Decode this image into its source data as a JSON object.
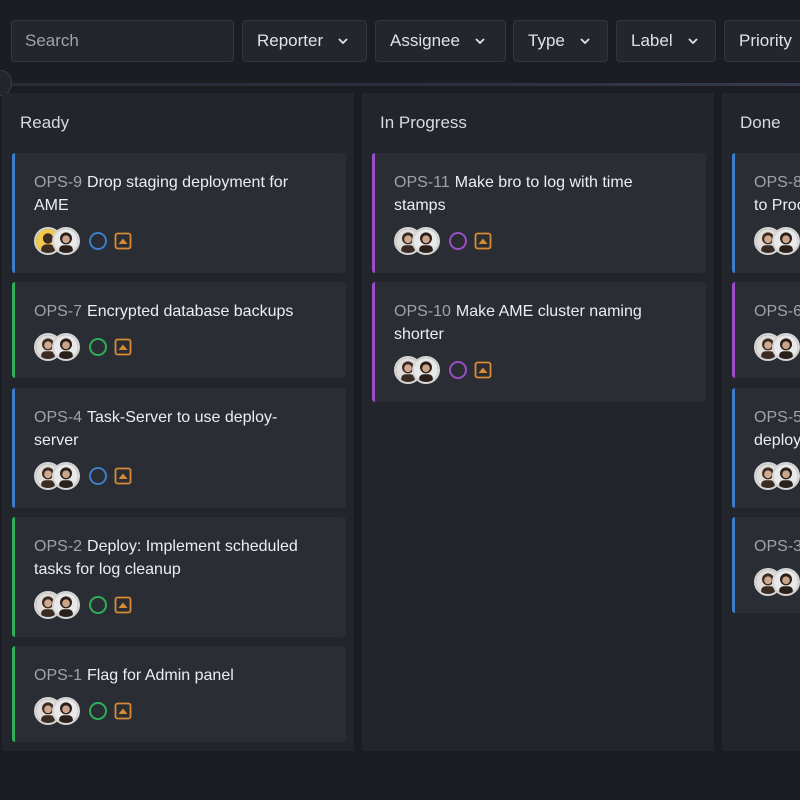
{
  "filters": {
    "search_placeholder": "Search",
    "reporter": "Reporter",
    "assignee": "Assignee",
    "type": "Type",
    "label": "Label",
    "priority": "Priority"
  },
  "colors": {
    "status_open_blue": "#3d7dca",
    "status_done_green": "#2fae5a",
    "status_progress_purple": "#9a4fc6",
    "priority_orange": "#d98a35"
  },
  "columns": [
    {
      "title": "Ready",
      "cards": [
        {
          "key": "OPS-9",
          "title": "Drop staging deployment for AME",
          "status": "open",
          "priority_icon": "priority-up-icon"
        },
        {
          "key": "OPS-7",
          "title": "Encrypted database backups",
          "status": "done",
          "priority_icon": "priority-up-icon"
        },
        {
          "key": "OPS-4",
          "title": "Task-Server to use deploy-server",
          "status": "open",
          "priority_icon": "priority-up-icon"
        },
        {
          "key": "OPS-2",
          "title": "Deploy: Implement scheduled tasks for log cleanup",
          "status": "done",
          "priority_icon": "priority-up-icon"
        },
        {
          "key": "OPS-1",
          "title": "Flag for Admin panel",
          "status": "done",
          "priority_icon": "priority-up-icon"
        }
      ]
    },
    {
      "title": "In Progress",
      "cards": [
        {
          "key": "OPS-11",
          "title": "Make bro to log with time stamps",
          "status": "progress",
          "priority_icon": "priority-up-icon"
        },
        {
          "key": "OPS-10",
          "title": "Make AME cluster naming shorter",
          "status": "progress",
          "priority_icon": "priority-up-icon"
        }
      ]
    },
    {
      "title": "Done",
      "cards": [
        {
          "key": "OPS-8",
          "title": "to Proc",
          "status": "open"
        },
        {
          "key": "OPS-6",
          "title": "",
          "status": "progress"
        },
        {
          "key": "OPS-5",
          "title": "deploy",
          "status": "open"
        },
        {
          "key": "OPS-3",
          "title": "",
          "status": "open"
        }
      ]
    }
  ]
}
